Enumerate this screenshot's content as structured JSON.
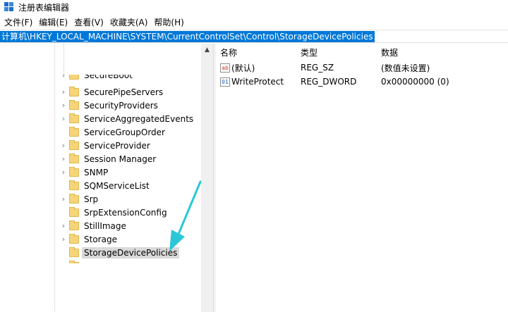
{
  "window": {
    "title": "注册表编辑器"
  },
  "menu": [
    "文件(F)",
    "编辑(E)",
    "查看(V)",
    "收藏夹(A)",
    "帮助(H)"
  ],
  "address": "计算机\\HKEY_LOCAL_MACHINE\\SYSTEM\\CurrentControlSet\\Control\\StorageDevicePolicies",
  "tree": {
    "partial_top": "SecureBoot",
    "items": [
      {
        "label": "SecurePipeServers",
        "expandable": true
      },
      {
        "label": "SecurityProviders",
        "expandable": true
      },
      {
        "label": "ServiceAggregatedEvents",
        "expandable": true
      },
      {
        "label": "ServiceGroupOrder",
        "expandable": false
      },
      {
        "label": "ServiceProvider",
        "expandable": true
      },
      {
        "label": "Session Manager",
        "expandable": true
      },
      {
        "label": "SNMP",
        "expandable": true
      },
      {
        "label": "SQMServiceList",
        "expandable": false
      },
      {
        "label": "Srp",
        "expandable": true
      },
      {
        "label": "SrpExtensionConfig",
        "expandable": false
      },
      {
        "label": "StillImage",
        "expandable": true
      },
      {
        "label": "Storage",
        "expandable": true
      },
      {
        "label": "StorageDevicePolicies",
        "expandable": false,
        "selected": true
      }
    ]
  },
  "list": {
    "columns": [
      "名称",
      "类型",
      "数据"
    ],
    "rows": [
      {
        "icon": "ab",
        "name": "(默认)",
        "type": "REG_SZ",
        "data": "(数值未设置)"
      },
      {
        "icon": "bin",
        "name": "WriteProtect",
        "type": "REG_DWORD",
        "data": "0x00000000 (0)"
      }
    ]
  },
  "colors": {
    "selection": "#0078d7",
    "arrow": "#2cc7d6",
    "selected_node": "#d9d9d9"
  }
}
